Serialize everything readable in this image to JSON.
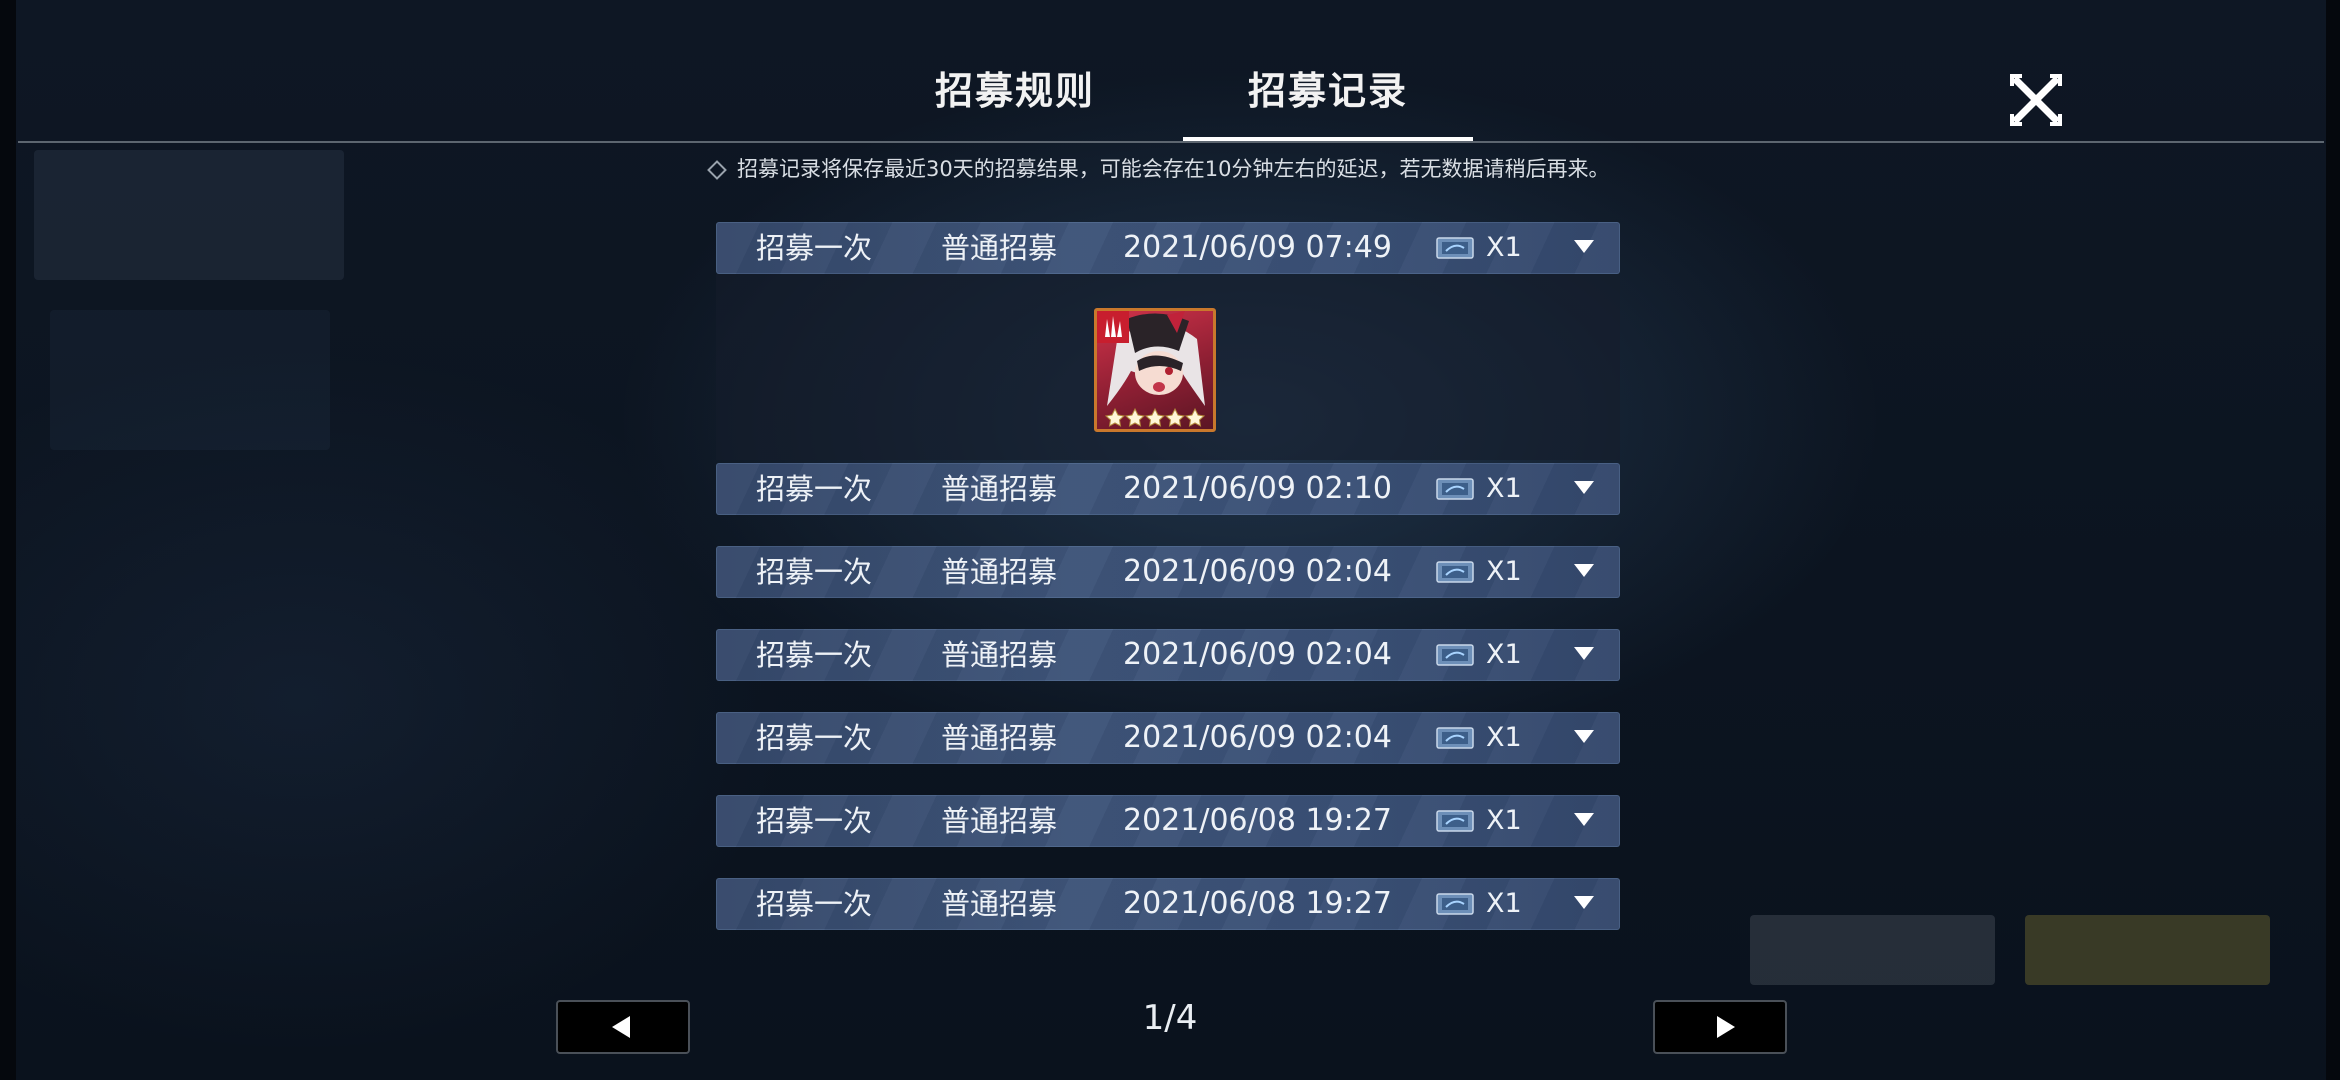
{
  "header": {
    "tabs": [
      {
        "label": "招募规则",
        "active": false
      },
      {
        "label": "招募记录",
        "active": true
      }
    ],
    "close_icon": "close-x-icon"
  },
  "notice": {
    "icon": "diamond-bullet-icon",
    "text": "招募记录将保存最近30天的招募结果，可能会存在10分钟左右的延迟，若无数据请稍后再来。"
  },
  "records": [
    {
      "type": "招募一次",
      "pool": "普通招募",
      "time": "2021/06/09 07:49",
      "ticket_icon": "recruit-ticket-icon",
      "count": "X1",
      "expanded": true
    },
    {
      "type": "招募一次",
      "pool": "普通招募",
      "time": "2021/06/09 02:10",
      "ticket_icon": "recruit-ticket-icon",
      "count": "X1",
      "expanded": false
    },
    {
      "type": "招募一次",
      "pool": "普通招募",
      "time": "2021/06/09 02:04",
      "ticket_icon": "recruit-ticket-icon",
      "count": "X1",
      "expanded": false
    },
    {
      "type": "招募一次",
      "pool": "普通招募",
      "time": "2021/06/09 02:04",
      "ticket_icon": "recruit-ticket-icon",
      "count": "X1",
      "expanded": false
    },
    {
      "type": "招募一次",
      "pool": "普通招募",
      "time": "2021/06/09 02:04",
      "ticket_icon": "recruit-ticket-icon",
      "count": "X1",
      "expanded": false
    },
    {
      "type": "招募一次",
      "pool": "普通招募",
      "time": "2021/06/08 19:27",
      "ticket_icon": "recruit-ticket-icon",
      "count": "X1",
      "expanded": false
    },
    {
      "type": "招募一次",
      "pool": "普通招募",
      "time": "2021/06/08 19:27",
      "ticket_icon": "recruit-ticket-icon",
      "count": "X1",
      "expanded": false
    }
  ],
  "result": {
    "character_icon": "character-portrait-icon",
    "element_icon": "fire-element-icon",
    "stars": 5,
    "colors": {
      "border": "#c9782c",
      "card_bg": "#d2334a"
    }
  },
  "pagination": {
    "current": "1/4",
    "prev_icon": "triangle-left-icon",
    "next_icon": "triangle-right-icon"
  },
  "colors": {
    "row_bg": "#3e5479",
    "background": "#0b1320",
    "text": "#eef2f7"
  }
}
